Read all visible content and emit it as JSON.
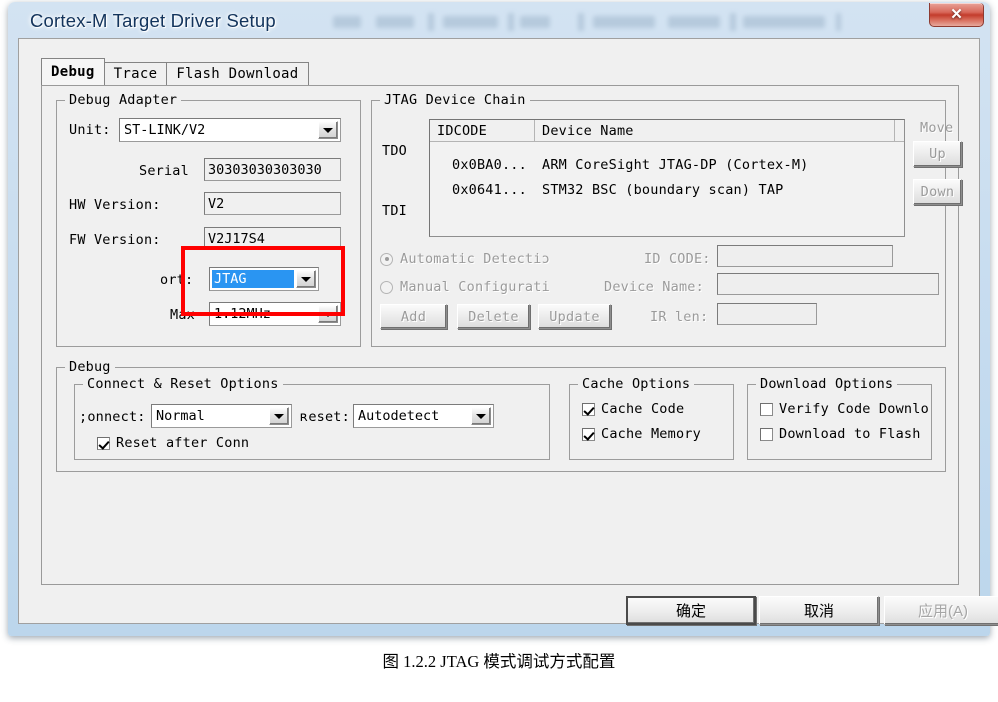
{
  "window": {
    "title": "Cortex-M Target Driver Setup",
    "close_label": "✕"
  },
  "tabs": [
    {
      "label": "Debug",
      "active": true
    },
    {
      "label": "Trace",
      "active": false
    },
    {
      "label": "Flash Download",
      "active": false
    }
  ],
  "debug_adapter": {
    "legend": "Debug Adapter",
    "unit_label": "Unit:",
    "unit_value": "ST-LINK/V2",
    "serial_label": "Serial",
    "serial_value": "30303030303030",
    "hw_version_label": "HW Version:",
    "hw_version_value": "V2",
    "fw_version_label": "FW Version:",
    "fw_version_value": "V2J17S4",
    "port_label": "ort:",
    "port_value": "JTAG",
    "max_label": "Max",
    "max_value": "1.12MHz"
  },
  "jtag_chain": {
    "legend": "JTAG Device Chain",
    "tdo_label": "TDO",
    "tdi_label": "TDI",
    "columns": [
      "IDCODE",
      "Device Name"
    ],
    "rows": [
      {
        "idcode": "0x0BA0...",
        "device_name": "ARM CoreSight JTAG-DP (Cortex-M)"
      },
      {
        "idcode": "0x0641...",
        "device_name": "STM32 BSC (boundary scan) TAP"
      }
    ],
    "move_label": "Move",
    "up_label": "Up",
    "down_label": "Down",
    "automatic_detection_label": "Automatic Detectiɔ",
    "manual_configuration_label": "Manual Configurati",
    "id_code_label": "ID CODE:",
    "id_code_value": "",
    "device_name_label": "Device Name:",
    "device_name_value": "",
    "ir_len_label": "IR len:",
    "ir_len_value": "",
    "add_label": "Add",
    "delete_label": "Delete",
    "update_label": "Update"
  },
  "debug_group": {
    "legend": "Debug",
    "connect_reset": {
      "legend": "Connect & Reset Options",
      "connect_label": ";onnect:",
      "connect_value": "Normal",
      "reset_label": "ʀeset:",
      "reset_value": "Autodetect",
      "reset_after_conn_label": "Reset after Conn",
      "reset_after_conn_checked": true
    },
    "cache_options": {
      "legend": "Cache Options",
      "items": [
        {
          "label": "Cache Code",
          "checked": true
        },
        {
          "label": "Cache Memory",
          "checked": true
        }
      ]
    },
    "download_options": {
      "legend": "Download Options",
      "items": [
        {
          "label": "Verify Code Downlo",
          "checked": false
        },
        {
          "label": "Download to Flash",
          "checked": false
        }
      ]
    }
  },
  "dialog_buttons": [
    {
      "label": "确定",
      "style": "default"
    },
    {
      "label": "取消",
      "style": "normal"
    },
    {
      "label": "应用(A)",
      "style": "disabled"
    }
  ],
  "caption": "图 1.2.2 JTAG 模式调试方式配置",
  "colors": {
    "highlight_box": "#ff0000",
    "selection": "#2a95f2",
    "title_text": "#13345c"
  }
}
